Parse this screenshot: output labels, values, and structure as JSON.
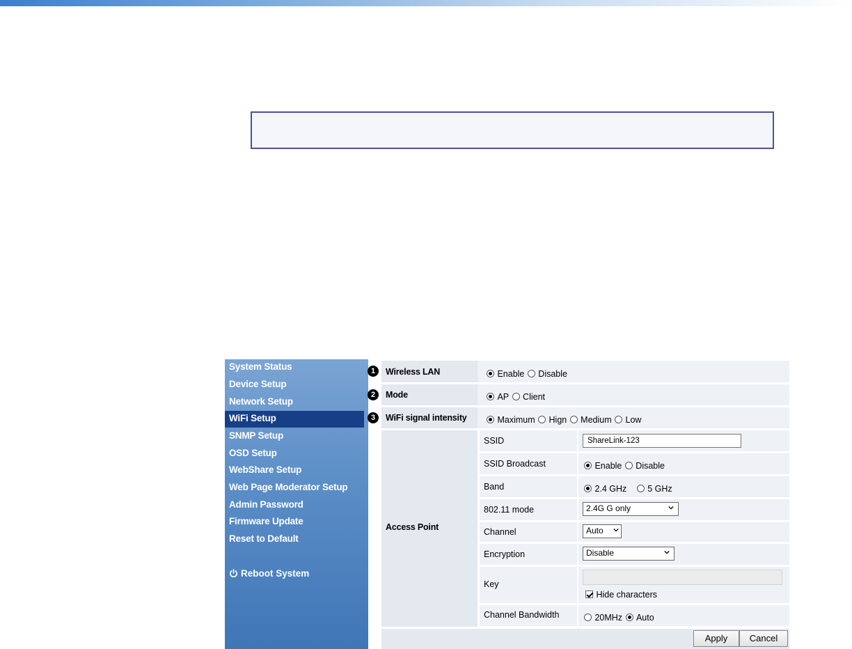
{
  "sidebar": {
    "items": [
      {
        "label": "System Status"
      },
      {
        "label": "Device Setup"
      },
      {
        "label": "Network Setup"
      },
      {
        "label": "WiFi Setup"
      },
      {
        "label": "SNMP Setup"
      },
      {
        "label": "OSD Setup"
      },
      {
        "label": "WebShare Setup"
      },
      {
        "label": "Web Page Moderator Setup"
      },
      {
        "label": "Admin Password"
      },
      {
        "label": "Firmware Update"
      },
      {
        "label": "Reset to Default"
      }
    ],
    "active_item": "WiFi Setup",
    "reboot_label": "Reboot System"
  },
  "wifi": {
    "wireless_lan": {
      "number": "1",
      "label": "Wireless LAN",
      "options": [
        "Enable",
        "Disable"
      ],
      "selected": "Enable"
    },
    "mode": {
      "number": "2",
      "label": "Mode",
      "options": [
        "AP",
        "Client"
      ],
      "selected": "AP"
    },
    "signal": {
      "number": "3",
      "label": "WiFi signal intensity",
      "options": [
        "Maximum",
        "Hign",
        "Medium",
        "Low"
      ],
      "selected": "Maximum"
    },
    "access_point": {
      "label": "Access Point",
      "ssid_label": "SSID",
      "ssid_value": "ShareLink-123",
      "broadcast_label": "SSID Broadcast",
      "broadcast_options": [
        "Enable",
        "Disable"
      ],
      "broadcast_selected": "Enable",
      "band_label": "Band",
      "band_options": [
        "2.4 GHz",
        "5 GHz"
      ],
      "band_selected": "2.4 GHz",
      "mode80211_label": "802.11 mode",
      "mode80211_value": "2.4G G only",
      "channel_label": "Channel",
      "channel_value": "Auto",
      "encryption_label": "Encryption",
      "encryption_value": "Disable",
      "key_label": "Key",
      "key_value": "",
      "hide_chars_label": "Hide characters",
      "hide_chars_checked": true,
      "bandwidth_label": "Channel Bandwidth",
      "bandwidth_options": [
        "20MHz",
        "Auto"
      ],
      "bandwidth_selected": "Auto"
    }
  },
  "buttons": {
    "apply": "Apply",
    "cancel": "Cancel"
  },
  "colors": {
    "sidebar_active": "#173f88",
    "sidebar_bg": "#5d8fc8",
    "note_border": "#4d4f9e"
  }
}
